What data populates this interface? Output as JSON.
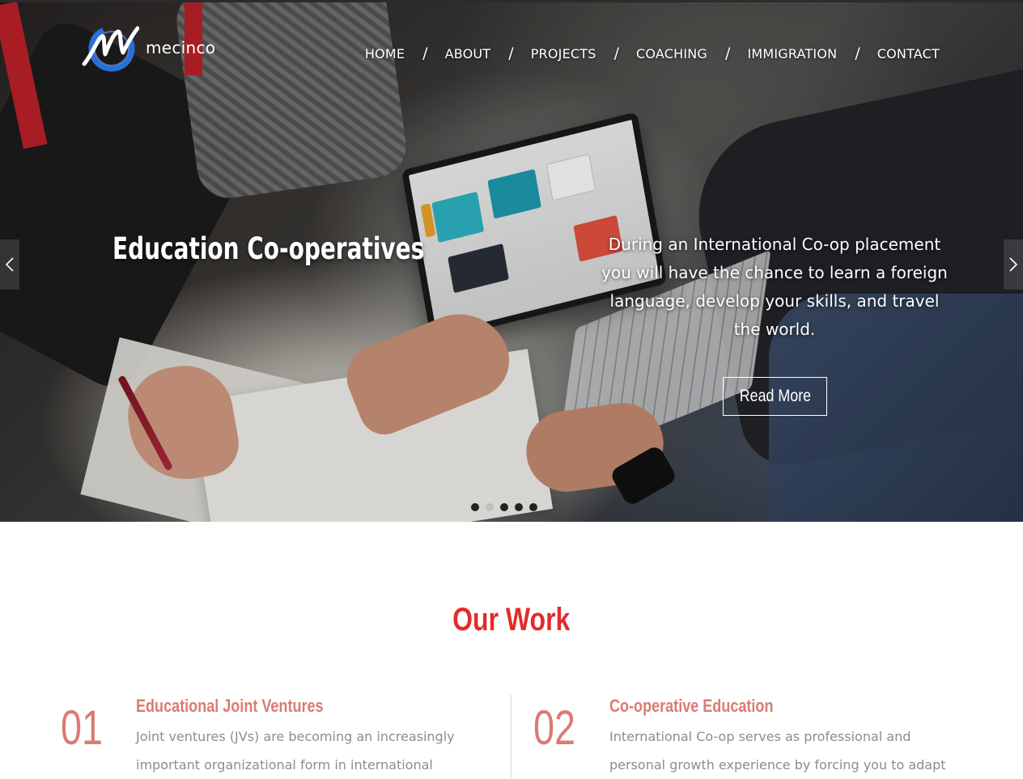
{
  "brand": {
    "name": "mecinco"
  },
  "nav": {
    "items": [
      {
        "label": "HOME"
      },
      {
        "label": "ABOUT"
      },
      {
        "label": "PROJECTS"
      },
      {
        "label": "COACHING"
      },
      {
        "label": "IMMIGRATION"
      },
      {
        "label": "CONTACT"
      }
    ],
    "separator": "/"
  },
  "hero": {
    "title": "Education Co-operatives",
    "description": "During an International Co-op placement you will have the chance to learn a foreign language, develop your skills, and travel the world.",
    "button_label": "Read More",
    "slides_total": 5,
    "active_slide": 2
  },
  "our_work": {
    "title": "Our Work",
    "items": [
      {
        "number": "01",
        "heading": "Educational Joint Ventures",
        "text": "Joint ventures (JVs) are becoming an increasingly important organizational form in international business."
      },
      {
        "number": "02",
        "heading": "Co-operative Education",
        "text": "International Co-op serves as professional and personal growth experience by forcing you to adapt to a new"
      }
    ]
  },
  "colors": {
    "accent_red": "#e32b2b",
    "accent_salmon": "#d97c74",
    "body_text": "#8d8d8d",
    "logo_blue": "#2a6fd6"
  },
  "icons": {
    "prev": "chevron-left-icon",
    "next": "chevron-right-icon",
    "logo": "brush-m-logo"
  }
}
